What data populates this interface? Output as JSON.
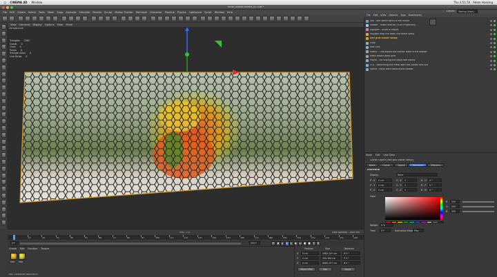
{
  "mac_menu": {
    "app": "CINEMA 4D",
    "window": "Window",
    "right_text": "Thu 3:51:55 · Adam Hosking"
  },
  "window_title": "NOW_VideoContent_02.c4d *",
  "c4d_menu": [
    "File",
    "Edit",
    "Create",
    "Select",
    "Tools",
    "Mesh",
    "Snap",
    "Animate",
    "Simulate",
    "Render",
    "Sculpt",
    "Motion Tracker",
    "MoGraph",
    "Character",
    "Pipeline",
    "Plugins",
    "Lightwave",
    "Script",
    "Window",
    "Help"
  ],
  "layout_label": "Layout:",
  "layout_value": "Startup (User)",
  "viewport": {
    "menu": [
      "View",
      "Cameras",
      "Display",
      "Options",
      "Filter",
      "Panel"
    ],
    "label": "Perspective",
    "hud": [
      [
        "Triangles",
        "2562"
      ],
      [
        "Quads",
        "0"
      ],
      [
        "Lines",
        "0"
      ],
      [
        "Points",
        "0"
      ],
      [
        "Triangle strips",
        "0"
      ],
      [
        "Line Strips",
        "0"
      ]
    ],
    "fps": "FPS : 7.0",
    "grid_spacing": "Grid Spacing : 1000 cm"
  },
  "timeline": {
    "ticks": [
      "0",
      "10",
      "20",
      "30",
      "40",
      "50",
      "60",
      "70",
      "80",
      "90",
      "100",
      "110",
      "120",
      "130",
      "140",
      "150",
      "160",
      "170",
      "180",
      "190",
      "200",
      "210",
      "220",
      "230",
      "240"
    ],
    "current_frame": "0 F",
    "start_field": "0 F",
    "end_field": "250 F",
    "end_label": "0 F"
  },
  "material_manager": {
    "menu": [
      "Create",
      "Edit",
      "Function",
      "Texture"
    ],
    "materials": [
      "Mat",
      "Mat"
    ],
    "status": "Rot: Horizontal (Normal X)"
  },
  "coordinates": {
    "headers": [
      "Position",
      "Size",
      "Rotation"
    ],
    "rows": [
      {
        "axis": "X",
        "pos": "0 cm",
        "size": "2082.747 cm",
        "rot": "H 0 °"
      },
      {
        "axis": "Y",
        "pos": "0 cm",
        "size": "305.164 cm",
        "rot": "P 0 °"
      },
      {
        "axis": "Z",
        "pos": "0 cm",
        "size": "8080.357 cm",
        "rot": "B 0 °"
      }
    ],
    "mode": "Object (Rel)",
    "mode2": "Size",
    "apply": "Apply"
  },
  "object_manager": {
    "menu": [
      "File",
      "Edit",
      "View",
      "Objects",
      "Tags",
      "Bookmarks"
    ],
    "objects": [
      {
        "name": "Sky - add some lights to the scene",
        "color": "#6ea0d8",
        "highlight": false
      },
      {
        "name": "Shader - Video overlay (Y-UV Projection)",
        "color": "#9ec6e8",
        "highlight": false
      },
      {
        "name": "Explorer - Scale in Polyss",
        "color": "#c58aa8",
        "highlight": false
      },
      {
        "name": "Polygon map the Web Grid mesh setup",
        "color": "#c7b060",
        "highlight": false
      },
      {
        "name": "hex grid cloner setup",
        "color": "#e0a020",
        "highlight": true
      },
      {
        "name": "Floor",
        "color": "#8bb2d6",
        "highlight": false
      },
      {
        "name": "Hex Grid",
        "color": "#8bb2d6",
        "highlight": false
      },
      {
        "name": "Matrix - This places the clones' base in the shader",
        "color": "#a3a3a3",
        "highlight": false
      },
      {
        "name": "Mesh based proof grid",
        "color": "#a3a3a3",
        "highlight": false
      },
      {
        "name": "Polyfx - For scaling the polys like clones",
        "color": "#7ab0e0",
        "highlight": false
      },
      {
        "name": "FFD - Deforming the mesh with the clones rolls out",
        "color": "#7ab0e0",
        "highlight": false
      },
      {
        "name": "Spline - Polys with stand-alone shader",
        "color": "#7ab0e0",
        "highlight": false
      }
    ]
  },
  "attributes": {
    "menu": [
      "Mode",
      "Edit",
      "User Data"
    ],
    "object_title": "Cloner Object [hex grid cloner setup]",
    "tabs": [
      "Basic",
      "Coord.",
      "Object",
      "Transform",
      "Effectors"
    ],
    "active_tab": "Transform",
    "section": "Transform",
    "display_label": "Display",
    "display_value": "None",
    "rows": [
      {
        "label": "P . X",
        "value": "0 cm",
        "label2": "S . X",
        "value2": "1",
        "label3": "R . H",
        "value3": "0 °"
      },
      {
        "label": "P . Y",
        "value": "0 cm",
        "label2": "S . Y",
        "value2": "1",
        "label3": "R . P",
        "value3": "0 °"
      },
      {
        "label": "P . Z",
        "value": "0 cm",
        "label2": "S . Z",
        "value2": "1",
        "label3": "R . B",
        "value3": "0 °"
      }
    ],
    "color_label": "Color",
    "rgb": [
      {
        "label": "R",
        "value": "255"
      },
      {
        "label": "G",
        "value": "255"
      },
      {
        "label": "B",
        "value": "255"
      }
    ],
    "weight_label": "Weight",
    "weight_value": "0 %",
    "time_label": "Time",
    "time_value": "0 F",
    "anim_mode_label": "Animation Mode",
    "anim_mode_value": "Play",
    "swatches": [
      "#e02020",
      "#f0a020",
      "#f0f020",
      "#20c040",
      "#20c0c0",
      "#2060e0",
      "#c020e0",
      "#f0f0f0",
      "#808080",
      "#202020"
    ]
  }
}
